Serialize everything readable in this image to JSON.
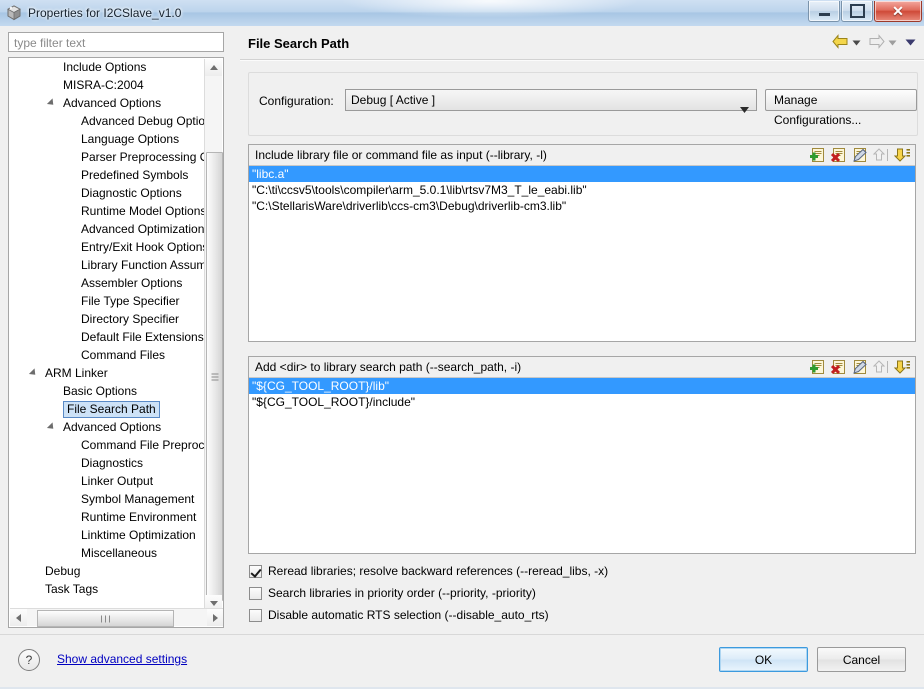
{
  "window": {
    "title": "Properties for I2CSlave_v1.0",
    "icon": "properties-cube-icon",
    "buttons": {
      "minimize": "minimize-icon",
      "restore": "restore-icon",
      "close": "close-icon"
    }
  },
  "filter": {
    "placeholder": "type filter text",
    "value": ""
  },
  "tree": {
    "selected": "File Search Path",
    "items": [
      {
        "label": "Include Options",
        "indent": 2,
        "expander": false
      },
      {
        "label": "MISRA-C:2004",
        "indent": 2,
        "expander": false
      },
      {
        "label": "Advanced Options",
        "indent": 2,
        "expander": true
      },
      {
        "label": "Advanced Debug Options",
        "indent": 3,
        "expander": false
      },
      {
        "label": "Language Options",
        "indent": 3,
        "expander": false
      },
      {
        "label": "Parser Preprocessing Options",
        "indent": 3,
        "expander": false
      },
      {
        "label": "Predefined Symbols",
        "indent": 3,
        "expander": false
      },
      {
        "label": "Diagnostic Options",
        "indent": 3,
        "expander": false
      },
      {
        "label": "Runtime Model Options",
        "indent": 3,
        "expander": false
      },
      {
        "label": "Advanced Optimizations",
        "indent": 3,
        "expander": false
      },
      {
        "label": "Entry/Exit Hook Options",
        "indent": 3,
        "expander": false
      },
      {
        "label": "Library Function Assumptions",
        "indent": 3,
        "expander": false
      },
      {
        "label": "Assembler Options",
        "indent": 3,
        "expander": false
      },
      {
        "label": "File Type Specifier",
        "indent": 3,
        "expander": false
      },
      {
        "label": "Directory Specifier",
        "indent": 3,
        "expander": false
      },
      {
        "label": "Default File Extensions",
        "indent": 3,
        "expander": false
      },
      {
        "label": "Command Files",
        "indent": 3,
        "expander": false
      },
      {
        "label": "ARM Linker",
        "indent": 1,
        "expander": true
      },
      {
        "label": "Basic Options",
        "indent": 2,
        "expander": false
      },
      {
        "label": "File Search Path",
        "indent": 2,
        "expander": false,
        "selected": true
      },
      {
        "label": "Advanced Options",
        "indent": 2,
        "expander": true
      },
      {
        "label": "Command File Preprocessing",
        "indent": 3,
        "expander": false
      },
      {
        "label": "Diagnostics",
        "indent": 3,
        "expander": false
      },
      {
        "label": "Linker Output",
        "indent": 3,
        "expander": false
      },
      {
        "label": "Symbol Management",
        "indent": 3,
        "expander": false
      },
      {
        "label": "Runtime Environment",
        "indent": 3,
        "expander": false
      },
      {
        "label": "Linktime Optimization",
        "indent": 3,
        "expander": false
      },
      {
        "label": "Miscellaneous",
        "indent": 3,
        "expander": false
      },
      {
        "label": "Debug",
        "indent": 1,
        "expander": false
      },
      {
        "label": "Task Tags",
        "indent": 1,
        "expander": false
      }
    ]
  },
  "page": {
    "title": "File Search Path",
    "nav": {
      "back": "back-arrow-icon",
      "back_menu": "chevron-down-icon",
      "forward": "forward-arrow-icon",
      "forward_menu": "chevron-down-icon",
      "view_menu": "chevron-down-icon"
    }
  },
  "configuration": {
    "label": "Configuration:",
    "value": "Debug  [ Active ]",
    "manage_button": "Manage Configurations..."
  },
  "library_list": {
    "header": "Include library file or command file as input (--library, -l)",
    "tools": [
      "add-icon",
      "delete-icon",
      "edit-icon",
      "move-up-icon",
      "move-down-icon"
    ],
    "rows": [
      {
        "value": "\"libc.a\"",
        "selected": true
      },
      {
        "value": "\"C:\\ti\\ccsv5\\tools\\compiler\\arm_5.0.1\\lib\\rtsv7M3_T_le_eabi.lib\"",
        "selected": false
      },
      {
        "value": "\"C:\\StellarisWare\\driverlib\\ccs-cm3\\Debug\\driverlib-cm3.lib\"",
        "selected": false
      }
    ]
  },
  "search_path_list": {
    "header": "Add <dir> to library search path (--search_path, -i)",
    "tools": [
      "add-icon",
      "delete-icon",
      "edit-icon",
      "move-up-icon",
      "move-down-icon"
    ],
    "rows": [
      {
        "value": "\"${CG_TOOL_ROOT}/lib\"",
        "selected": true
      },
      {
        "value": "\"${CG_TOOL_ROOT}/include\"",
        "selected": false
      }
    ]
  },
  "checkboxes": [
    {
      "label": "Reread libraries; resolve backward references (--reread_libs, -x)",
      "checked": true
    },
    {
      "label": "Search libraries in priority order (--priority, -priority)",
      "checked": false
    },
    {
      "label": "Disable automatic RTS selection (--disable_auto_rts)",
      "checked": false
    }
  ],
  "footer": {
    "help_icon": "help-icon",
    "advanced_link": "Show advanced settings",
    "ok": "OK",
    "cancel": "Cancel"
  },
  "colors": {
    "selection": "#3399ff",
    "tree_selection": "#cde2f7",
    "link": "#0000c0",
    "titlebar": "#bcd4ec"
  }
}
